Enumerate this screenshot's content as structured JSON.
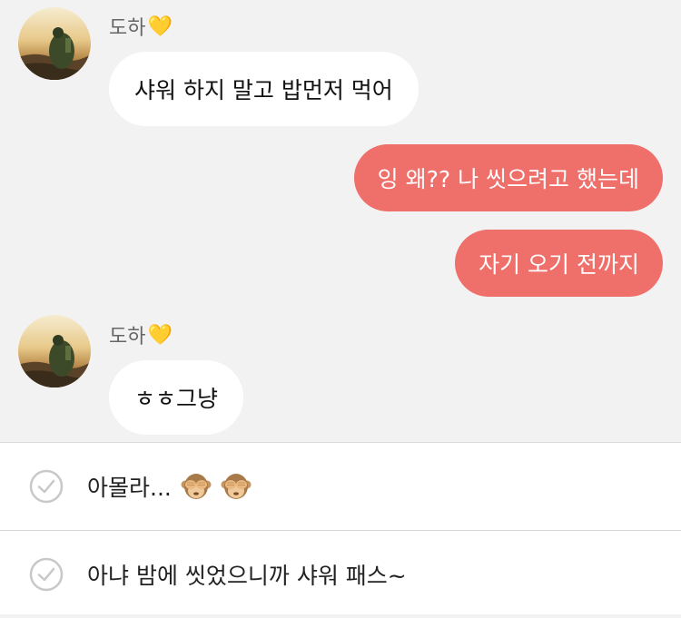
{
  "conversation": {
    "messages": [
      {
        "sender": "도하",
        "sender_heart": "💛",
        "text": "샤워 하지 말고 밥먼저 먹어",
        "direction": "incoming"
      },
      {
        "text": "잉 왜?? 나 씻으려고 했는데",
        "direction": "outgoing"
      },
      {
        "text": "자기 오기 전까지",
        "direction": "outgoing"
      },
      {
        "sender": "도하",
        "sender_heart": "💛",
        "text": "ㅎㅎ그냥",
        "direction": "incoming"
      }
    ]
  },
  "reply_options": [
    {
      "text": "아몰라...",
      "icons": [
        "see-no-evil-monkey",
        "see-no-evil-monkey"
      ]
    },
    {
      "text": "아냐 밤에 씻었으니까 샤워 패스~"
    }
  ],
  "colors": {
    "background": "#f2f2f2",
    "incoming_bubble": "#ffffff",
    "outgoing_bubble": "#ef6f6a",
    "outgoing_text": "#ffffff",
    "sender_name": "#666666"
  }
}
